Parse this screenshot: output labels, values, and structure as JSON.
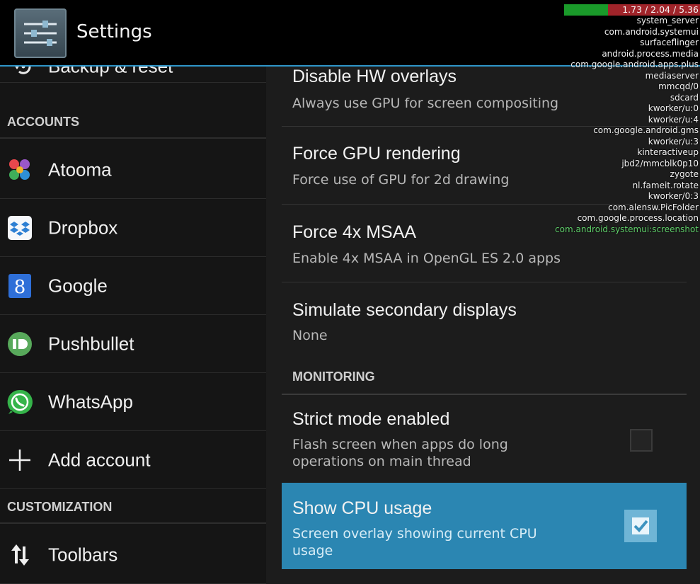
{
  "actionbar": {
    "title": "Settings",
    "icon": "settings-sliders-icon"
  },
  "left_pane": {
    "partial_item": {
      "label": "Backup & reset",
      "icon": "backup-restore-icon"
    },
    "accounts_header": "ACCOUNTS",
    "accounts": [
      {
        "label": "Atooma",
        "icon": "atooma-icon"
      },
      {
        "label": "Dropbox",
        "icon": "dropbox-icon"
      },
      {
        "label": "Google",
        "icon": "google-icon"
      },
      {
        "label": "Pushbullet",
        "icon": "pushbullet-icon"
      },
      {
        "label": "WhatsApp",
        "icon": "whatsapp-icon"
      },
      {
        "label": "Add account",
        "icon": "plus-icon"
      }
    ],
    "customization_header": "CUSTOMIZATION",
    "customization": [
      {
        "label": "Toolbars",
        "icon": "toolbars-arrows-icon"
      }
    ]
  },
  "right_pane": {
    "prefs": [
      {
        "title": "Disable HW overlays",
        "summary": "Always use GPU for screen compositing"
      },
      {
        "title": "Force GPU rendering",
        "summary": "Force use of GPU for 2d drawing"
      },
      {
        "title": "Force 4x MSAA",
        "summary": "Enable 4x MSAA in OpenGL ES 2.0 apps"
      },
      {
        "title": "Simulate secondary displays",
        "summary": "None"
      }
    ],
    "monitoring_header": "MONITORING",
    "monitoring": [
      {
        "title": "Strict mode enabled",
        "summary_line1": "Flash screen when apps do long",
        "summary_line2": "operations on main thread",
        "checked": false
      },
      {
        "title": "Show CPU usage",
        "summary_line1": "Screen overlay showing current CPU",
        "summary_line2": "usage",
        "checked": true
      }
    ]
  },
  "cpu_overlay": {
    "load": "1.73 / 2.04 / 5.36",
    "processes": [
      "system_server",
      "com.android.systemui",
      "surfaceflinger",
      "android.process.media",
      "com.google.android.apps.plus",
      "mediaserver",
      "mmcqd/0",
      "sdcard",
      "kworker/u:0",
      "kworker/u:4",
      "com.google.android.gms",
      "kworker/u:3",
      "kinteractiveup",
      "jbd2/mmcblk0p10",
      "zygote",
      "nl.fameit.rotate",
      "kworker/0:3",
      "com.alensw.PicFolder",
      "com.google.process.location",
      "com.android.systemui:screenshot"
    ]
  },
  "colors": {
    "accent": "#2e95c8",
    "selected_row": "#2b86b2",
    "cpu_green": "#1a9a2a",
    "cpu_red": "#a0242a"
  }
}
